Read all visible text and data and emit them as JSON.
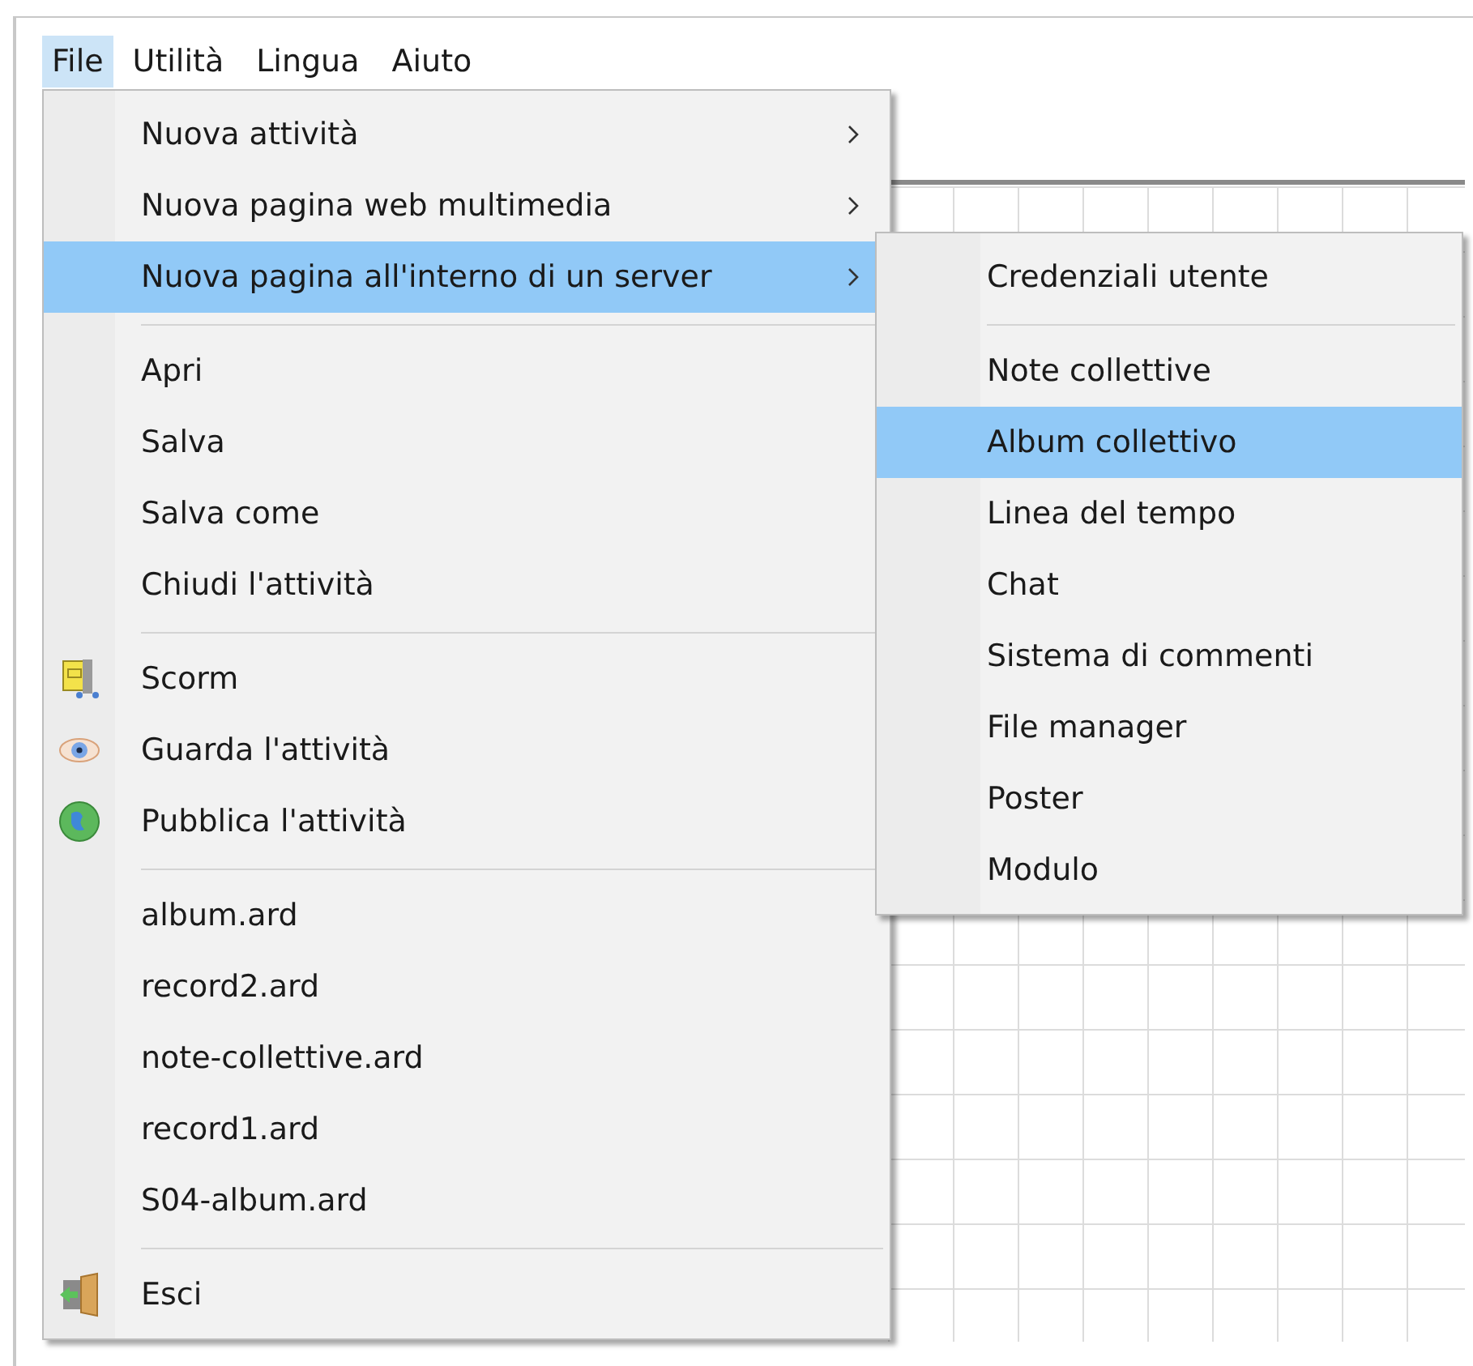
{
  "menu_bar": [
    {
      "label": "File",
      "selected": true
    },
    {
      "label": "Utilità",
      "selected": false
    },
    {
      "label": "Lingua",
      "selected": false
    },
    {
      "label": "Aiuto",
      "selected": false
    }
  ],
  "file_menu": [
    {
      "kind": "submenu",
      "label": "Nuova attività",
      "selected": false
    },
    {
      "kind": "submenu",
      "label": "Nuova pagina web multimedia",
      "selected": false
    },
    {
      "kind": "submenu",
      "label": "Nuova pagina all'interno di un server",
      "selected": true
    },
    {
      "kind": "separator"
    },
    {
      "kind": "item",
      "label": "Apri",
      "selected": false
    },
    {
      "kind": "item",
      "label": "Salva",
      "selected": false
    },
    {
      "kind": "item",
      "label": "Salva come",
      "selected": false
    },
    {
      "kind": "item",
      "label": "Chiudi l'attività",
      "selected": false
    },
    {
      "kind": "separator"
    },
    {
      "kind": "package",
      "label": "Scorm",
      "selected": false
    },
    {
      "kind": "eye",
      "label": "Guarda l'attività",
      "selected": false
    },
    {
      "kind": "globe",
      "label": "Pubblica l'attività",
      "selected": false
    },
    {
      "kind": "separator"
    },
    {
      "kind": "item",
      "label": "album.ard",
      "selected": false
    },
    {
      "kind": "item",
      "label": "record2.ard",
      "selected": false
    },
    {
      "kind": "item",
      "label": "note-collettive.ard",
      "selected": false
    },
    {
      "kind": "item",
      "label": "record1.ard",
      "selected": false
    },
    {
      "kind": "item",
      "label": "S04-album.ard",
      "selected": false
    },
    {
      "kind": "separator"
    },
    {
      "kind": "door",
      "label": "Esci",
      "selected": false
    }
  ],
  "submenu": [
    {
      "kind": "item",
      "label": "Credenziali utente",
      "selected": false
    },
    {
      "kind": "separator"
    },
    {
      "kind": "item",
      "label": "Note collettive",
      "selected": false
    },
    {
      "kind": "item",
      "label": "Album collettivo",
      "selected": true
    },
    {
      "kind": "item",
      "label": "Linea del tempo",
      "selected": false
    },
    {
      "kind": "item",
      "label": "Chat",
      "selected": false
    },
    {
      "kind": "item",
      "label": "Sistema di commenti",
      "selected": false
    },
    {
      "kind": "item",
      "label": "File manager",
      "selected": false
    },
    {
      "kind": "item",
      "label": "Poster",
      "selected": false
    },
    {
      "kind": "item",
      "label": "Modulo",
      "selected": false
    }
  ]
}
